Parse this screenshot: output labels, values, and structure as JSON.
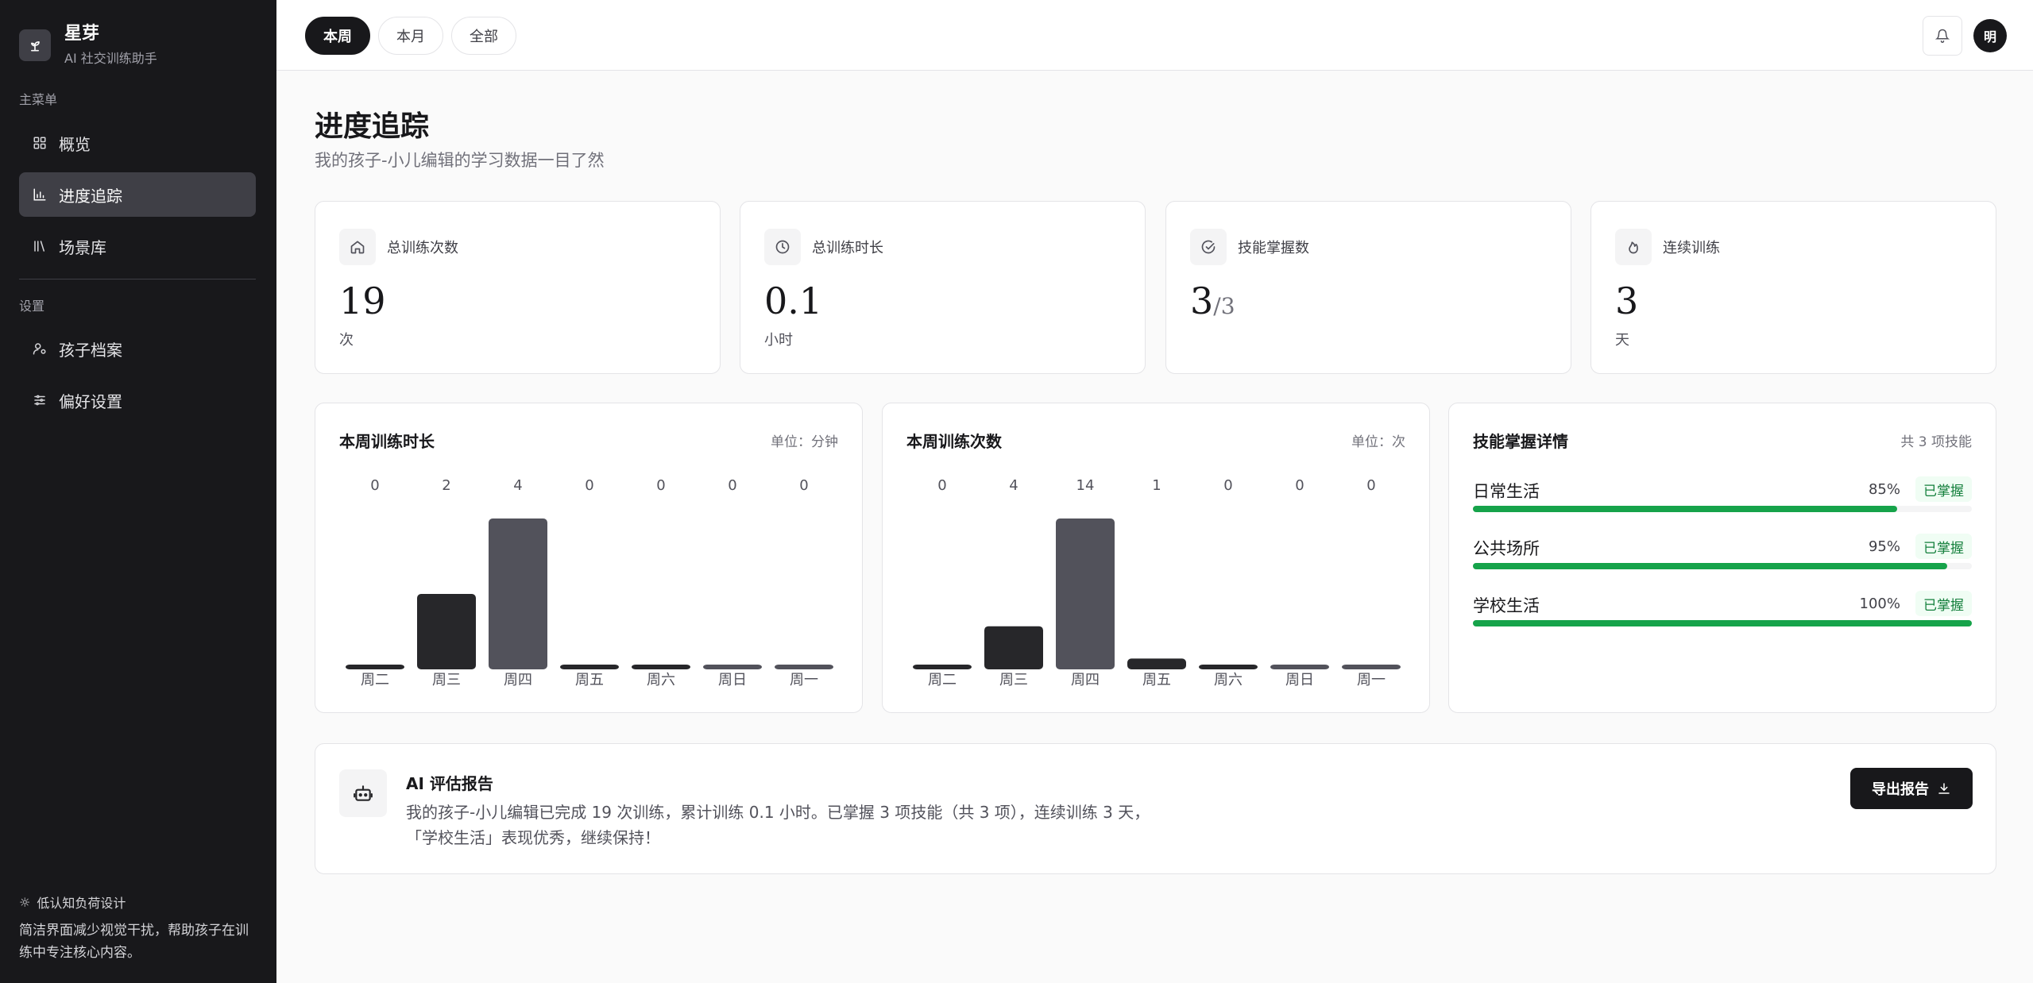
{
  "brand": {
    "name": "星芽",
    "subtitle": "AI 社交训练助手"
  },
  "sidebar": {
    "main_label": "主菜单",
    "items": [
      {
        "label": "概览",
        "icon": "grid-icon"
      },
      {
        "label": "进度追踪",
        "icon": "bar-chart-icon",
        "active": true
      },
      {
        "label": "场景库",
        "icon": "library-icon"
      }
    ],
    "settings_label": "设置",
    "settings_items": [
      {
        "label": "孩子档案",
        "icon": "user-settings-icon"
      },
      {
        "label": "偏好设置",
        "icon": "sliders-icon"
      }
    ],
    "footer": {
      "title": "低认知负荷设计",
      "desc": "简洁界面减少视觉干扰，帮助孩子在训练中专注核心内容。"
    }
  },
  "topbar": {
    "filters": [
      "本周",
      "本月",
      "全部"
    ],
    "active_filter": "本周",
    "avatar_text": "明"
  },
  "page": {
    "title": "进度追踪",
    "subtitle": "我的孩子-小儿编辑的学习数据一目了然"
  },
  "stats": [
    {
      "label": "总训练次数",
      "value": "19",
      "denom": "",
      "unit": "次",
      "icon": "home-icon"
    },
    {
      "label": "总训练时长",
      "value": "0.1",
      "denom": "",
      "unit": "小时",
      "icon": "clock-icon"
    },
    {
      "label": "技能掌握数",
      "value": "3",
      "denom": "/3",
      "unit": "",
      "icon": "check-circle-icon"
    },
    {
      "label": "连续训练",
      "value": "3",
      "denom": "",
      "unit": "天",
      "icon": "flame-icon"
    }
  ],
  "chart_data": [
    {
      "type": "bar",
      "title": "本周训练时长",
      "unit_label": "单位：分钟",
      "categories": [
        "周二",
        "周三",
        "周四",
        "周五",
        "周六",
        "周日",
        "周一"
      ],
      "values": [
        0,
        2,
        4,
        0,
        0,
        0,
        0
      ]
    },
    {
      "type": "bar",
      "title": "本周训练次数",
      "unit_label": "单位：次",
      "categories": [
        "周二",
        "周三",
        "周四",
        "周五",
        "周六",
        "周日",
        "周一"
      ],
      "values": [
        0,
        4,
        14,
        1,
        0,
        0,
        0
      ]
    }
  ],
  "skills": {
    "title": "技能掌握详情",
    "count_label": "共 3 项技能",
    "items": [
      {
        "name": "日常生活",
        "pct": "85%",
        "value": 0.85,
        "badge": "已掌握"
      },
      {
        "name": "公共场所",
        "pct": "95%",
        "value": 0.95,
        "badge": "已掌握"
      },
      {
        "name": "学校生活",
        "pct": "100%",
        "value": 1.0,
        "badge": "已掌握"
      }
    ]
  },
  "report": {
    "title": "AI 评估报告",
    "line1": "我的孩子-小儿编辑已完成 19 次训练，累计训练 0.1 小时。已掌握 3 项技能（共 3 项），连续训练 3 天，",
    "line2": "「学校生活」表现优秀，继续保持！",
    "export_label": "导出报告"
  },
  "colors": {
    "sidebar_bg": "#18181b",
    "bar_dark": "#27272a",
    "bar_gray": "#52525b",
    "success": "#16a34a"
  }
}
